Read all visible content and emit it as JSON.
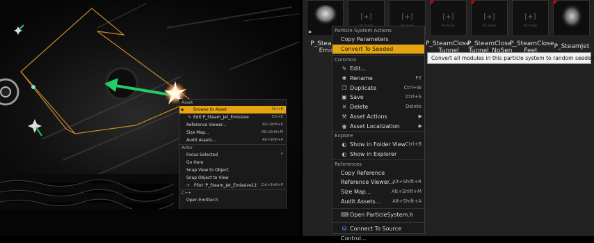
{
  "left_menu": {
    "sections": [
      {
        "header": "Asset",
        "items": [
          {
            "label": "Browse to Asset",
            "shortcut": "Ctrl+B",
            "selected": true,
            "icon": "browse-icon"
          },
          {
            "label": "Edit P_Steam_Jet_Emissive",
            "shortcut": "Ctrl+E",
            "icon": "edit-icon"
          },
          {
            "label": "Reference Viewer...",
            "shortcut": "Alt+Shift+R"
          },
          {
            "label": "Size Map...",
            "shortcut": "Alt+Shift+M"
          },
          {
            "label": "Audit Assets...",
            "shortcut": "Alt+Shift+A"
          }
        ]
      },
      {
        "header": "Actor",
        "items": [
          {
            "label": "Focus Selected",
            "shortcut": "F"
          },
          {
            "label": "Go Here",
            "shortcut": ""
          },
          {
            "label": "Snap View to Object",
            "shortcut": ""
          },
          {
            "label": "Snap Object to View",
            "shortcut": ""
          },
          {
            "label": "Pilot 'P_Steam_Jet_Emissive11'",
            "shortcut": "Ctrl+Shift+P",
            "icon": "pilot-icon"
          }
        ]
      },
      {
        "header": "C++",
        "items": [
          {
            "label": "Open Emitter.h",
            "shortcut": ""
          }
        ]
      }
    ]
  },
  "thumbnails": [
    {
      "label": "P_Steam_\nEmissi",
      "has_image": true
    },
    {
      "label": "",
      "has_image": false
    },
    {
      "label": "",
      "has_image": false
    },
    {
      "label": "P_SteamClose_\nTunnel",
      "has_image": false
    },
    {
      "label": "P_SteamClose_\nTunnel_NoSen",
      "has_image": false
    },
    {
      "label": "P_SteamClose\nFeet",
      "has_image": false
    },
    {
      "label": "P_SteamJet",
      "has_image": true
    }
  ],
  "no_image_text": "No Image",
  "right_menu": {
    "sections": [
      {
        "header": "Particle System Actions",
        "items": [
          {
            "label": "Copy Parameters",
            "shortcut": ""
          },
          {
            "label": "Convert To Seeded",
            "shortcut": "",
            "selected": true
          }
        ]
      },
      {
        "header": "Common",
        "items": [
          {
            "label": "Edit...",
            "shortcut": "",
            "icon": "edit-icon",
            "glyph": "✎"
          },
          {
            "label": "Rename",
            "shortcut": "F2",
            "icon": "rename-icon",
            "glyph": "✱"
          },
          {
            "label": "Duplicate",
            "shortcut": "Ctrl+W",
            "icon": "duplicate-icon",
            "glyph": "❐"
          },
          {
            "label": "Save",
            "shortcut": "Ctrl+S",
            "icon": "save-icon",
            "glyph": "▣"
          },
          {
            "label": "Delete",
            "shortcut": "Delete",
            "icon": "delete-icon",
            "glyph": "✕"
          },
          {
            "label": "Asset Actions",
            "shortcut": "",
            "icon": "wrench-icon",
            "glyph": "⚒",
            "submenu": true
          },
          {
            "label": "Asset Localization",
            "shortcut": "",
            "icon": "globe-icon",
            "glyph": "◉",
            "submenu": true
          }
        ]
      },
      {
        "header": "Explore",
        "items": [
          {
            "label": "Show in Folder View",
            "shortcut": "Ctrl+B",
            "icon": "folder-icon",
            "glyph": "◐"
          },
          {
            "label": "Show in Explorer",
            "shortcut": "",
            "icon": "explorer-icon",
            "glyph": "◐"
          }
        ]
      },
      {
        "header": "References",
        "items": [
          {
            "label": "Copy Reference",
            "shortcut": ""
          },
          {
            "label": "Reference Viewer...",
            "shortcut": "Alt+Shift+R"
          },
          {
            "label": "Size Map...",
            "shortcut": "Alt+Shift+M"
          },
          {
            "label": "Audit Assets...",
            "shortcut": "Alt+Shift+A"
          }
        ]
      },
      {
        "header": "",
        "items": [
          {
            "label": "Open ParticleSystem.h",
            "shortcut": "",
            "icon": "code-icon",
            "glyph": "⌨"
          }
        ]
      },
      {
        "header": "",
        "items": [
          {
            "label": "Connect To Source Control...",
            "shortcut": "",
            "icon": "source-control-icon",
            "glyph": "⛁"
          }
        ]
      }
    ]
  },
  "tooltip": "Convert all modules in this particle system to random seeded modules",
  "colors": {
    "accent": "#e5a512",
    "gizmo_green": "#22cc66"
  }
}
